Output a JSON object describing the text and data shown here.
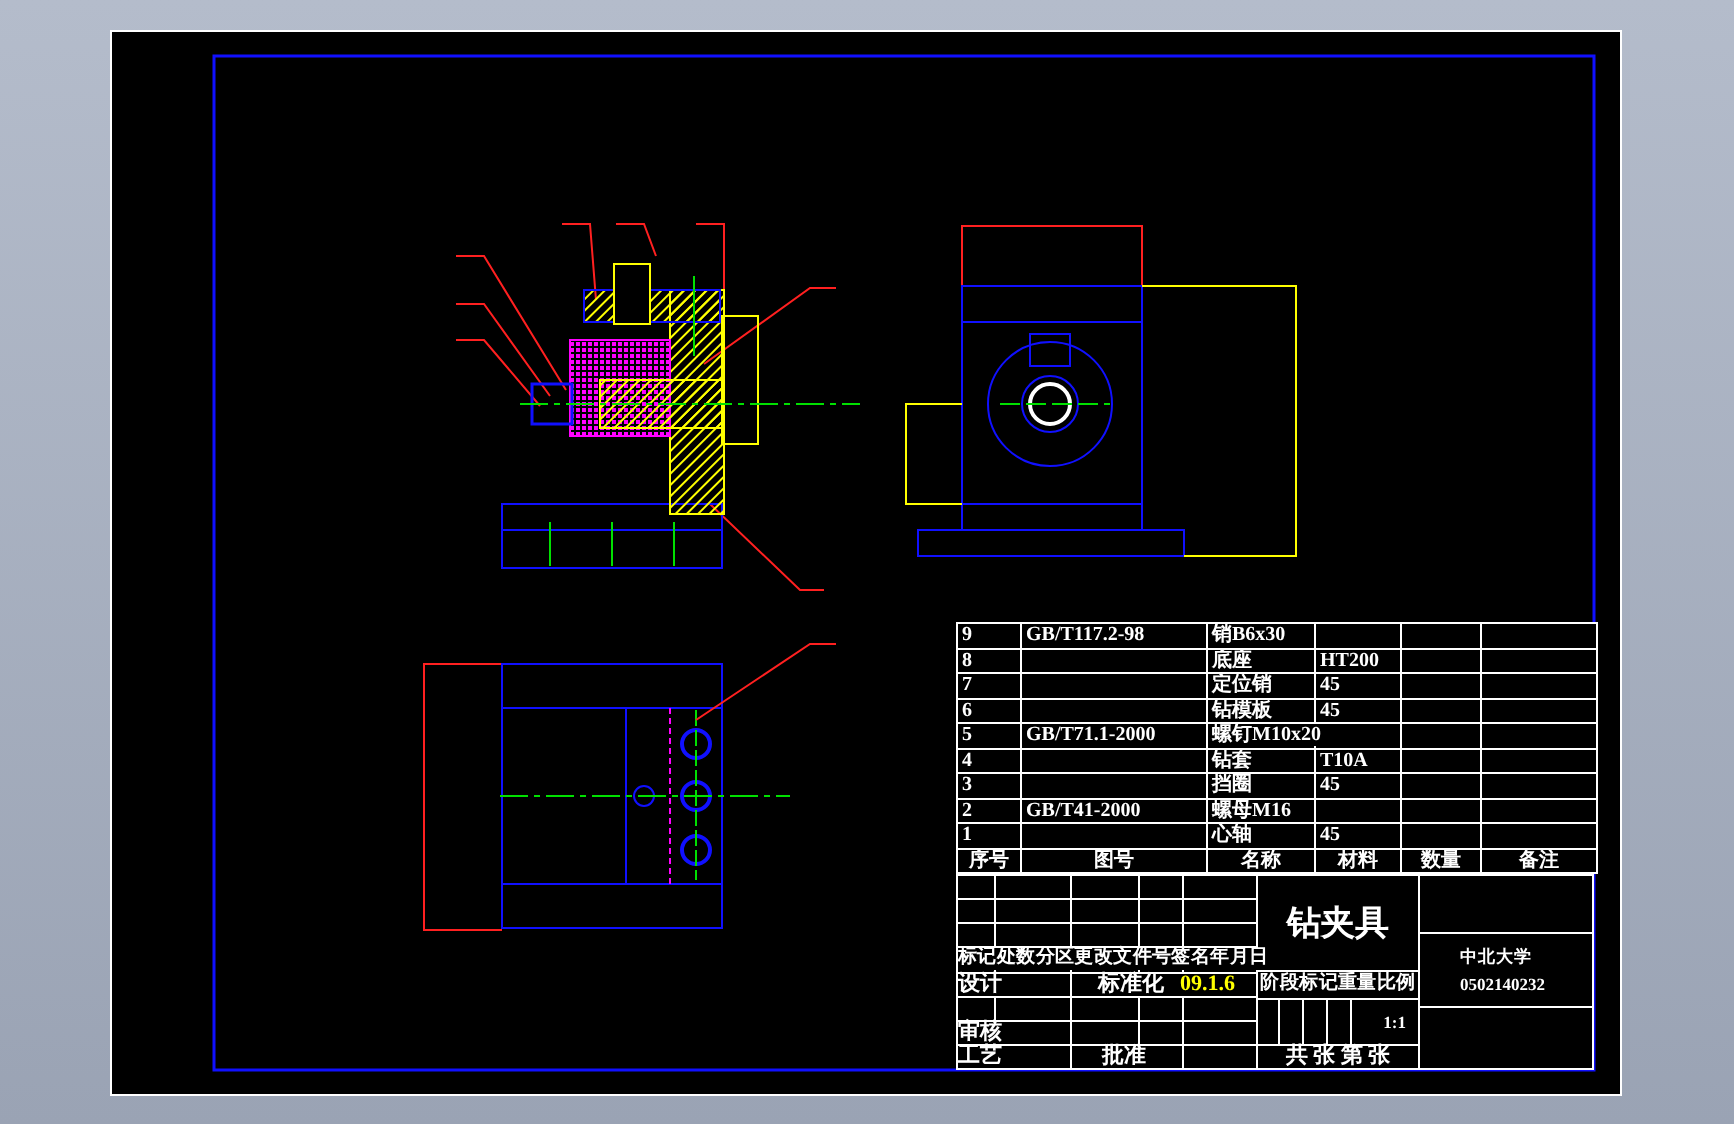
{
  "parts_list": {
    "columns": [
      "序号",
      "图号",
      "名称",
      "材料",
      "数量",
      "备注"
    ],
    "rows": [
      {
        "no": "9",
        "code": "GB/T117.2-98",
        "name": "销B6x30"
      },
      {
        "no": "8",
        "name": "底座",
        "material": "HT200"
      },
      {
        "no": "7",
        "name": "定位销",
        "material": "45"
      },
      {
        "no": "6",
        "name": "钻模板",
        "material": "45"
      },
      {
        "no": "5",
        "code": "GB/T71.1-2000",
        "name": "螺钉M10x20"
      },
      {
        "no": "4",
        "name": "钻套",
        "material": "T10A"
      },
      {
        "no": "3",
        "name": "挡圈",
        "material": "45"
      },
      {
        "no": "2",
        "code": "GB/T41-2000",
        "name": "螺母M16"
      },
      {
        "no": "1",
        "name": "心轴",
        "material": "45"
      }
    ]
  },
  "title_block": {
    "drawing_title": "钻夹具",
    "change_header": "标记处数分区更改文件号签名年月日",
    "designer_label": "设计",
    "standardization_label": "标准化",
    "date": "09.1.6",
    "stage_header": "阶段标记重量比例",
    "scale": "1:1",
    "sheet_count": "共 张 第 张",
    "reviewer_label": "审核",
    "process_label": "工艺",
    "approver_label": "批准",
    "school": "中北大学",
    "student_id": "0502140232"
  }
}
